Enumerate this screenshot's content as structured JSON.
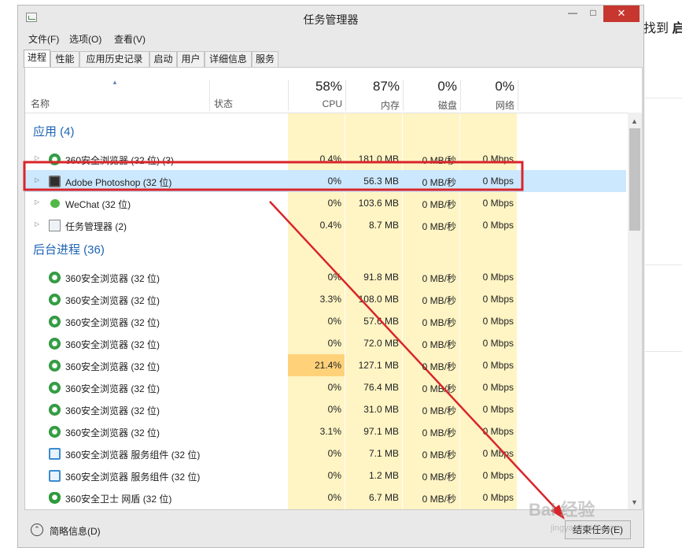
{
  "window": {
    "title": "任务管理器"
  },
  "background_page": {
    "text_prefix": "找到",
    "text_bold": "启"
  },
  "menu": {
    "items": [
      "文件(F)",
      "选项(O)",
      "查看(V)"
    ]
  },
  "tabs": [
    "进程",
    "性能",
    "应用历史记录",
    "启动",
    "用户",
    "详细信息",
    "服务"
  ],
  "header": {
    "name_label": "名称",
    "status_label": "状态",
    "cpu_pct": "58%",
    "cpu_label": "CPU",
    "mem_pct": "87%",
    "mem_label": "内存",
    "disk_pct": "0%",
    "disk_label": "磁盘",
    "net_pct": "0%",
    "net_label": "网络"
  },
  "groups": {
    "apps": "应用 (4)",
    "background": "后台进程 (36)"
  },
  "apps": [
    {
      "name": "360安全浏览器 (32 位) (3)",
      "icon": "browser-360-icon",
      "cpu": "0.4%",
      "mem": "181.0 MB",
      "disk": "0 MB/秒",
      "net": "0 Mbps"
    },
    {
      "name": "Adobe Photoshop (32 位)",
      "icon": "photoshop-icon",
      "cpu": "0%",
      "mem": "56.3 MB",
      "disk": "0 MB/秒",
      "net": "0 Mbps"
    },
    {
      "name": "WeChat (32 位)",
      "icon": "wechat-icon",
      "cpu": "0%",
      "mem": "103.6 MB",
      "disk": "0 MB/秒",
      "net": "0 Mbps"
    },
    {
      "name": "任务管理器 (2)",
      "icon": "task-manager-icon",
      "cpu": "0.4%",
      "mem": "8.7 MB",
      "disk": "0 MB/秒",
      "net": "0 Mbps"
    }
  ],
  "background": [
    {
      "name": "360安全浏览器 (32 位)",
      "icon": "browser-360-icon",
      "cpu": "0%",
      "mem": "91.8 MB",
      "disk": "0 MB/秒",
      "net": "0 Mbps"
    },
    {
      "name": "360安全浏览器 (32 位)",
      "icon": "browser-360-icon",
      "cpu": "3.3%",
      "mem": "108.0 MB",
      "disk": "0 MB/秒",
      "net": "0 Mbps"
    },
    {
      "name": "360安全浏览器 (32 位)",
      "icon": "browser-360-icon",
      "cpu": "0%",
      "mem": "57.6 MB",
      "disk": "0 MB/秒",
      "net": "0 Mbps"
    },
    {
      "name": "360安全浏览器 (32 位)",
      "icon": "browser-360-icon",
      "cpu": "0%",
      "mem": "72.0 MB",
      "disk": "0 MB/秒",
      "net": "0 Mbps"
    },
    {
      "name": "360安全浏览器 (32 位)",
      "icon": "browser-360-icon",
      "cpu": "21.4%",
      "mem": "127.1 MB",
      "disk": "0 MB/秒",
      "net": "0 Mbps"
    },
    {
      "name": "360安全浏览器 (32 位)",
      "icon": "browser-360-icon",
      "cpu": "0%",
      "mem": "76.4 MB",
      "disk": "0 MB/秒",
      "net": "0 Mbps"
    },
    {
      "name": "360安全浏览器 (32 位)",
      "icon": "browser-360-icon",
      "cpu": "0%",
      "mem": "31.0 MB",
      "disk": "0 MB/秒",
      "net": "0 Mbps"
    },
    {
      "name": "360安全浏览器 (32 位)",
      "icon": "browser-360-icon",
      "cpu": "3.1%",
      "mem": "97.1 MB",
      "disk": "0 MB/秒",
      "net": "0 Mbps"
    },
    {
      "name": "360安全浏览器 服务组件 (32 位)",
      "icon": "service-component-icon",
      "cpu": "0%",
      "mem": "7.1 MB",
      "disk": "0 MB/秒",
      "net": "0 Mbps"
    },
    {
      "name": "360安全浏览器 服务组件 (32 位)",
      "icon": "service-component-icon",
      "cpu": "0%",
      "mem": "1.2 MB",
      "disk": "0 MB/秒",
      "net": "0 Mbps"
    },
    {
      "name": "360安全卫士 网盾 (32 位)",
      "icon": "shield-icon",
      "cpu": "0%",
      "mem": "6.7 MB",
      "disk": "0 MB/秒",
      "net": "0 Mbps"
    }
  ],
  "footer": {
    "fewer_details": "简略信息(D)",
    "end_task": "结束任务(E)"
  },
  "watermark": {
    "main": "Bai 经验",
    "sub": "jingyan.baidu.com"
  },
  "colors": {
    "highlight_box": "#d9252a",
    "arrow": "#d9252a",
    "selected_row": "#cce8ff",
    "heat": "#fff4c4",
    "heat_high": "#ffd27a",
    "group_text": "#1e64b4"
  }
}
